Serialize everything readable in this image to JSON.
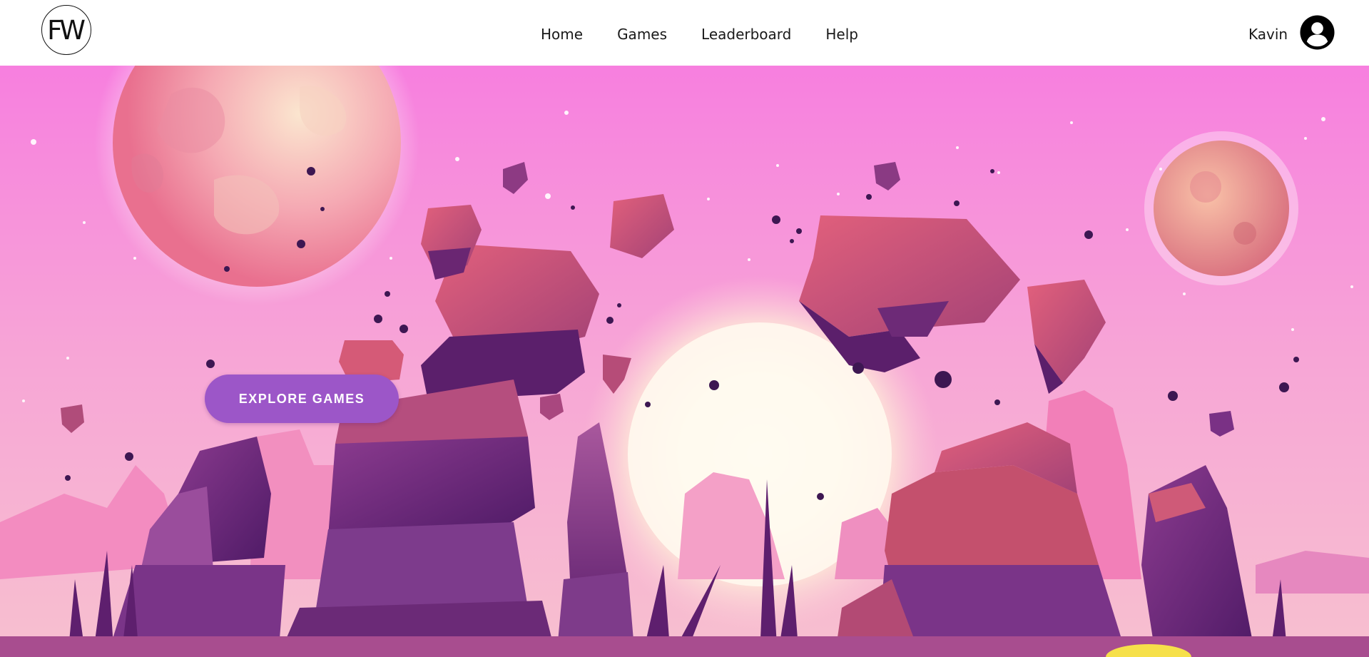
{
  "header": {
    "logo_text": "FW",
    "nav": [
      {
        "label": "Home"
      },
      {
        "label": "Games"
      },
      {
        "label": "Leaderboard"
      },
      {
        "label": "Help"
      }
    ],
    "user_name": "Kavin",
    "avatar_icon": "user-circle-icon"
  },
  "hero": {
    "cta_label": "EXPLORE GAMES",
    "illustration": "alien planet landscape with floating rocks, pink moons and glowing sun",
    "colors": {
      "sky_top": "#f77fdf",
      "sky_bottom": "#f8b6d2",
      "sun_glow": "#fff6e0",
      "rock_dark": "#5b1f6b",
      "rock_mid": "#8a3a8a",
      "rock_light": "#d85877",
      "button": "#9c56c8"
    }
  }
}
